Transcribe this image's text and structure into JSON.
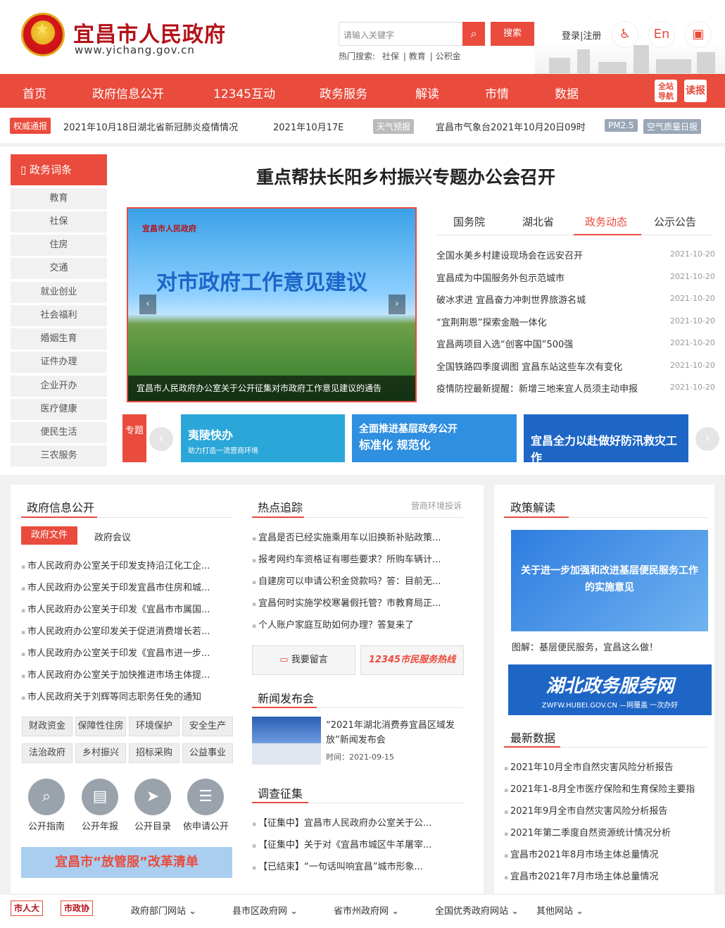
{
  "header": {
    "site_title": "宜昌市人民政府",
    "site_url": "www.yichang.gov.cn",
    "search_placeholder": "请输入关键字",
    "search_button": "搜索",
    "hot_label": "热门搜索:",
    "hot_words": [
      "社保",
      "教育",
      "公积金"
    ],
    "login": "登录|注册",
    "accessibility": "♿",
    "english": "En",
    "elder": "▣"
  },
  "nav": {
    "items": [
      "首页",
      "政府信息公开",
      "12345互动",
      "政务服务",
      "解读",
      "市情",
      "数据"
    ],
    "badge1": "全站导航",
    "badge2": "读报"
  },
  "ticker": {
    "tag": "权威通报",
    "item1": "2021年10月18日湖北省新冠肺炎疫情情况",
    "item2": "2021年10月17E",
    "weather_tag": "天气预报",
    "weather": "宜昌市气象台2021年10月20日09时",
    "pm": "PM2.5",
    "air": "空气质量日报"
  },
  "sidebar": {
    "title": "政务词条",
    "items": [
      "教育",
      "社保",
      "住房",
      "交通",
      "就业创业",
      "社会福利",
      "婚姻生育",
      "证件办理",
      "企业开办",
      "医疗健康",
      "便民生活",
      "三农服务"
    ]
  },
  "headline": "重点帮扶长阳乡村振兴专题办公会召开",
  "carousel": {
    "logo": "宜昌市人民政府",
    "title": "对市政府工作意见建议",
    "caption": "宜昌市人民政府办公室关于公开征集对市政府工作意见建议的通告",
    "prev": "‹",
    "next": "›"
  },
  "news_tabs": [
    "国务院",
    "湖北省",
    "政务动态",
    "公示公告"
  ],
  "news": [
    {
      "t": "全国水美乡村建设现场会在远安召开",
      "d": "2021-10-20"
    },
    {
      "t": "宜昌成为中国服务外包示范城市",
      "d": "2021-10-20"
    },
    {
      "t": "破冰求进 宜昌奋力冲刺世界旅游名城",
      "d": "2021-10-20"
    },
    {
      "t": "“宜荆荆恩”探索金融一体化",
      "d": "2021-10-20"
    },
    {
      "t": "宜昌两项目入选“创客中国”500强",
      "d": "2021-10-20"
    },
    {
      "t": "全国铁路四季度调图 宜昌东站这些车次有变化",
      "d": "2021-10-20"
    },
    {
      "t": "疫情防控最新提醒：新增三地来宜人员须主动申报",
      "d": "2021-10-20"
    }
  ],
  "topic": {
    "label": "专题",
    "banner1": "夷陵快办",
    "banner1_sub": "助力打造一流营商环境",
    "banner2": "全面推进基层政务公开",
    "banner2_sub": "标准化 规范化",
    "banner3": "宜昌全力以赴做好防汛救灾工作"
  },
  "info": {
    "title": "政府信息公开",
    "tab1": "政府文件",
    "tab2": "政府会议",
    "items": [
      "市人民政府办公室关于印发支持沿江化工企...",
      "市人民政府办公室关于印发宜昌市住房和城...",
      "市人民政府办公室关于印发《宜昌市市属国...",
      "市人民政府办公室印发关于促进消费增长若...",
      "市人民政府办公室关于印发《宜昌市进一步...",
      "市人民政府办公室关于加快推进市场主体提...",
      "市人民政府关于刘辉等同志职务任免的通知"
    ],
    "tags": [
      "财政资金",
      "保障性住房",
      "环境保护",
      "安全生产",
      "法治政府",
      "乡村振兴",
      "招标采购",
      "公益事业"
    ],
    "icons": [
      {
        "l": "公开指南",
        "i": "⌕"
      },
      {
        "l": "公开年报",
        "i": "▤"
      },
      {
        "l": "公开目录",
        "i": "➤"
      },
      {
        "l": "依申请公开",
        "i": "☰"
      }
    ],
    "banner": "宜昌市“放管服”改革清单"
  },
  "hot": {
    "title": "热点追踪",
    "more": "营商环境投诉",
    "items": [
      "宜昌是否已经实施乘用车以旧换新补贴政策...",
      "报考网约车资格证有哪些要求？所购车辆计...",
      "自建房可以申请公积金贷款吗？答：目前无...",
      "宜昌何时实施学校寒暑假托管？市教育局正...",
      "个人账户家庭互助如何办理？答复来了"
    ],
    "msg_btn": "我要留言",
    "hotline": "12345市民服务热线"
  },
  "press": {
    "title": "新闻发布会",
    "item": "“2021年湖北消费券宜昌区域发放”新闻发布会",
    "time": "时间：2021-09-15"
  },
  "survey": {
    "title": "调查征集",
    "items": [
      "【征集中】宜昌市人民政府办公室关于公...",
      "【征集中】关于对《宜昌市城区牛羊屠宰...",
      "【已结束】“一句话叫响宜昌”城市形象..."
    ]
  },
  "policy": {
    "title": "政策解读",
    "img_text": "关于进一步加强和改进基层便民服务工作的实施意见",
    "caption": "图解：基层便民服务，宜昌这么做！",
    "hubei": "湖北政务服务网",
    "hubei_sub": "ZWFW.HUBEI.GOV.CN —网覆盖 一次办好"
  },
  "data": {
    "title": "最新数据",
    "items": [
      "2021年10月全市自然灾害风险分析报告",
      "2021年1-8月全市医疗保险和生育保险主要指",
      "2021年9月全市自然灾害风险分析报告",
      "2021年第二季度自然资源统计情况分析",
      "宜昌市2021年8月市场主体总量情况",
      "宜昌市2021年7月市场主体总量情况"
    ]
  },
  "footer": {
    "logo1": "市人大",
    "logo2": "市政协",
    "links": [
      "政府部门网站",
      "县市区政府网",
      "省市州政府网",
      "全国优秀政府网站",
      "其他网站"
    ]
  }
}
